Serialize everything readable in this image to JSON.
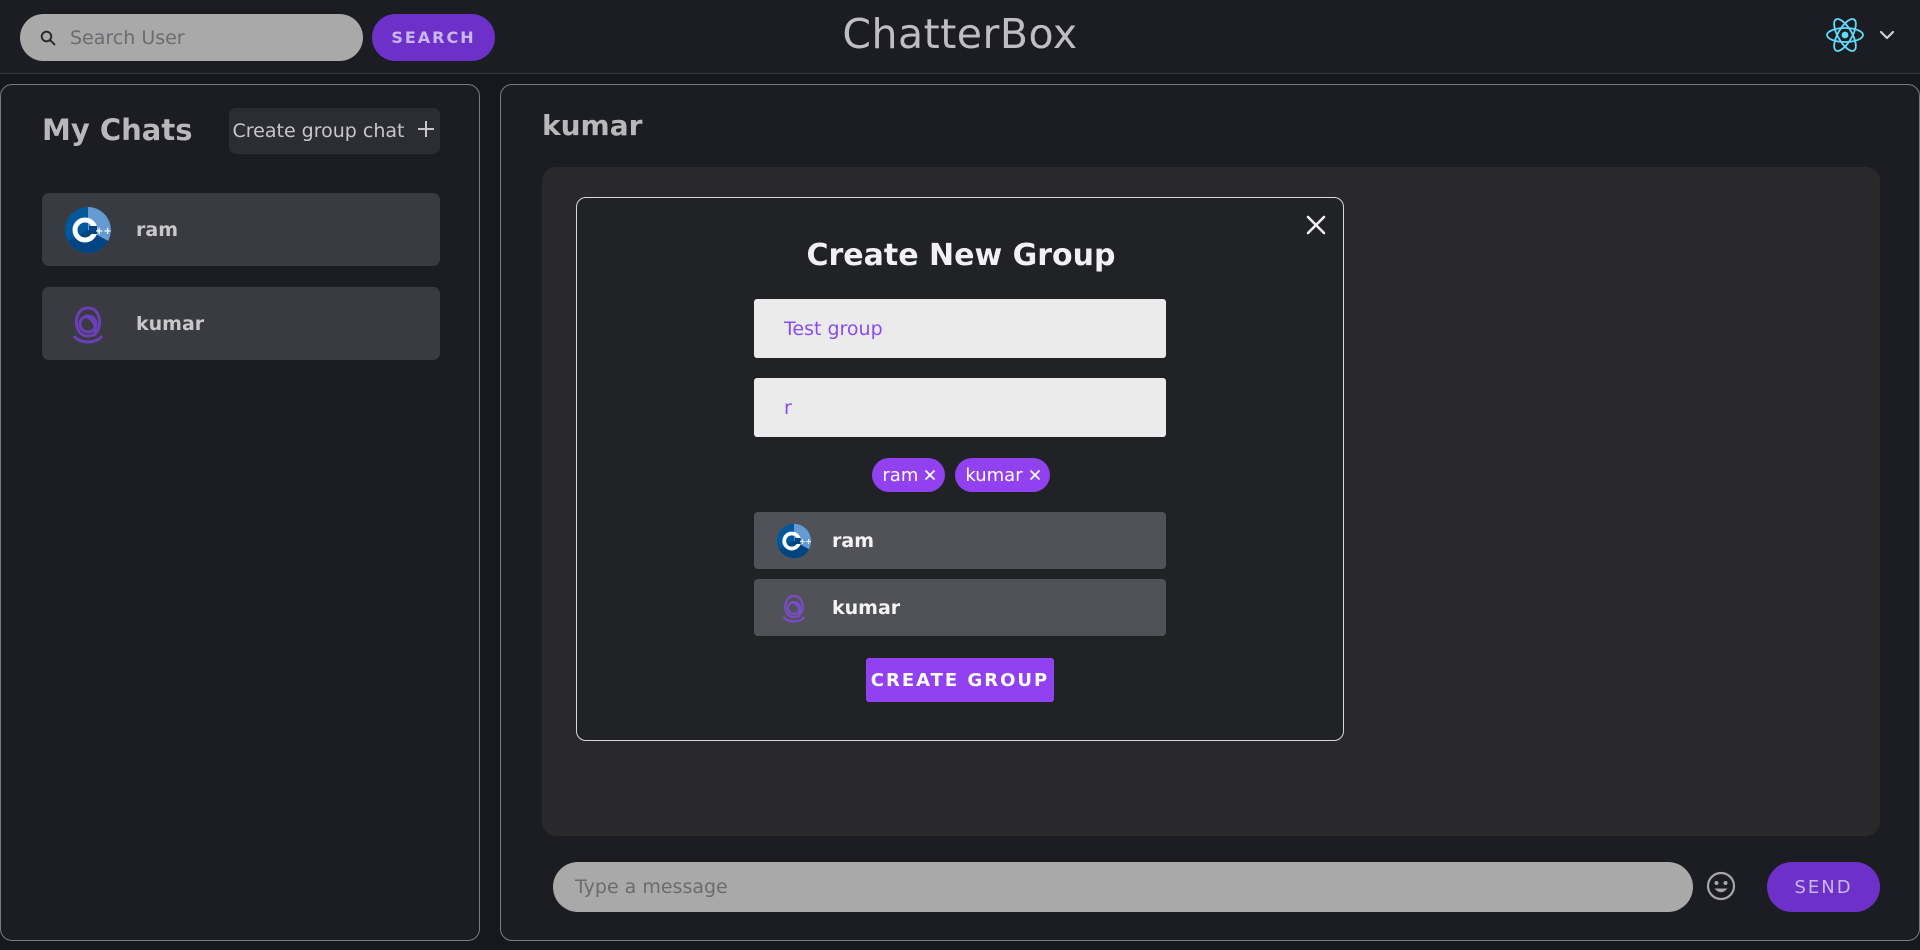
{
  "header": {
    "search_placeholder": "Search User",
    "search_button": "SEARCH",
    "brand": "ChatterBox",
    "profile_icon": "react-logo-icon",
    "menu_icon": "chevron-down-icon"
  },
  "sidebar": {
    "title": "My Chats",
    "create_group_label": "Create group chat",
    "chats": [
      {
        "name": "ram",
        "avatar": "cpp-logo-icon"
      },
      {
        "name": "kumar",
        "avatar": "redux-logo-icon"
      }
    ]
  },
  "chat": {
    "title": "kumar",
    "message_placeholder": "Type a message",
    "send_label": "SEND"
  },
  "modal": {
    "title": "Create New Group",
    "group_name_value": "Test group",
    "user_search_value": "r",
    "selected": [
      "ram",
      "kumar"
    ],
    "results": [
      {
        "name": "ram",
        "avatar": "cpp-logo-icon"
      },
      {
        "name": "kumar",
        "avatar": "redux-logo-icon"
      }
    ],
    "create_label": "CREATE GROUP"
  },
  "colors": {
    "accent": "#9141f0",
    "accent_dark": "#6d31c9",
    "background": "#17181d",
    "panel": "#1c1d22"
  }
}
